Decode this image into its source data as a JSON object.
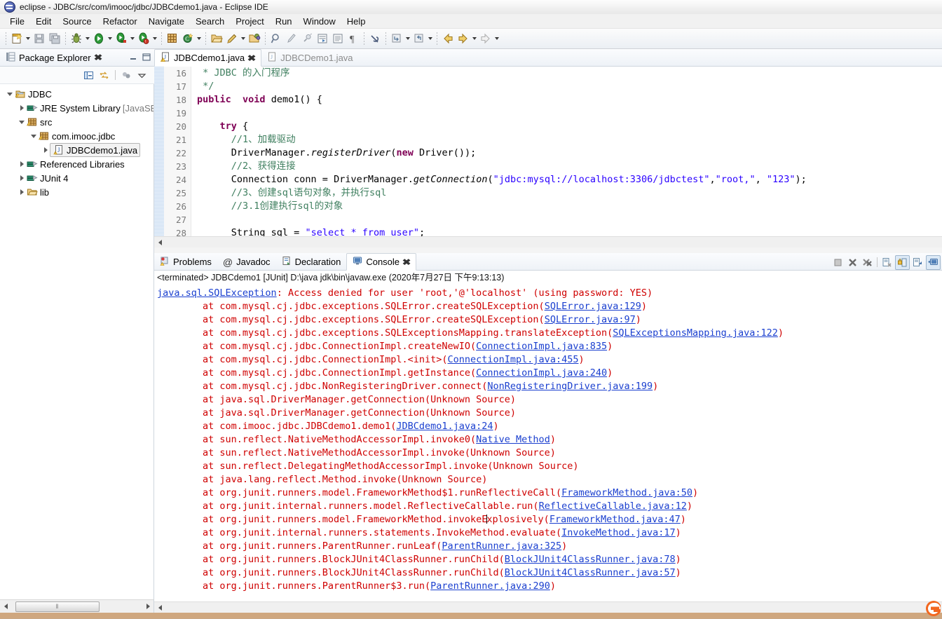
{
  "window": {
    "title": "eclipse - JDBC/src/com/imooc/jdbc/JDBCdemo1.java - Eclipse IDE",
    "logo_icon": "eclipse-logo-icon"
  },
  "menubar": {
    "items": [
      "File",
      "Edit",
      "Source",
      "Refactor",
      "Navigate",
      "Search",
      "Project",
      "Run",
      "Window",
      "Help"
    ]
  },
  "toolbar": {
    "groups": [
      {
        "buttons": [
          {
            "name": "new-wizard-icon",
            "glyph": "🗋",
            "color": "#e8b53a",
            "arrow": true
          },
          {
            "name": "save-icon",
            "glyph": "💾",
            "color": "#b9bec6",
            "arrow": false
          },
          {
            "name": "save-all-icon",
            "glyph": "🗐",
            "color": "#b9bec6",
            "arrow": false
          }
        ]
      },
      {
        "buttons": [
          {
            "name": "debug-icon",
            "glyph": "🐞",
            "color": "#6f8f3f",
            "arrow": true
          },
          {
            "name": "run-icon",
            "glyph": "▶",
            "color": "#2e9b3a",
            "arrow": true
          },
          {
            "name": "run-coverage-icon",
            "glyph": "▶",
            "color": "#2e9b3a",
            "arrow": true
          },
          {
            "name": "run-last-tool-icon",
            "glyph": "▶",
            "color": "#2e9b3a",
            "arrow": true
          }
        ]
      },
      {
        "buttons": [
          {
            "name": "new-java-package-icon",
            "glyph": "⊞",
            "color": "#c38a3c",
            "arrow": false
          },
          {
            "name": "new-java-class-icon",
            "glyph": "Ⓘ",
            "color": "#3a8f4a",
            "arrow": true
          }
        ]
      },
      {
        "buttons": [
          {
            "name": "open-type-icon",
            "glyph": "🗁",
            "color": "#d9a84b",
            "arrow": false
          },
          {
            "name": "quick-fix-icon",
            "glyph": "✎",
            "color": "#d2a23a",
            "arrow": true
          },
          {
            "name": "open-task-icon",
            "glyph": "🗂",
            "color": "#d9a84b",
            "arrow": false
          }
        ]
      },
      {
        "buttons": [
          {
            "name": "search-icon",
            "glyph": "🔍",
            "color": "#7f8fa0",
            "arrow": false
          },
          {
            "name": "pencil-icon",
            "glyph": "✒",
            "color": "#b0b6bd",
            "arrow": false
          },
          {
            "name": "link-icon",
            "glyph": "⚲",
            "color": "#b0b6bd",
            "arrow": false
          },
          {
            "name": "toggle-block-selection-icon",
            "glyph": "▤",
            "color": "#9aa1aa",
            "arrow": false
          },
          {
            "name": "show-whitespace-icon",
            "glyph": "☰",
            "color": "#9aa1aa",
            "arrow": false
          },
          {
            "name": "paragraph-mark-icon",
            "glyph": "¶",
            "color": "#6a6a6a",
            "arrow": false
          }
        ]
      },
      {
        "buttons": [
          {
            "name": "skip-breakpoints-icon",
            "glyph": "⊘",
            "color": "#4a5a7a",
            "arrow": false
          }
        ]
      },
      {
        "buttons": [
          {
            "name": "next-annotation-icon",
            "glyph": "⤵",
            "color": "#9aa1aa",
            "arrow": true
          },
          {
            "name": "previous-annotation-icon",
            "glyph": "⤴",
            "color": "#9aa1aa",
            "arrow": true
          }
        ]
      },
      {
        "buttons": [
          {
            "name": "back-navigation-icon",
            "glyph": "↩",
            "color": "#d6a53a",
            "arrow": false
          },
          {
            "name": "forward-navigation-icon",
            "glyph": "↪",
            "color": "#d6a53a",
            "arrow": true
          },
          {
            "name": "last-edit-location-icon",
            "glyph": "⇨",
            "color": "#c9c9c9",
            "arrow": true
          }
        ]
      }
    ]
  },
  "package_explorer": {
    "title": "Package Explorer",
    "close_icon": "close-icon",
    "view_icon": "package-explorer-icon",
    "minimize_icon": "minimize-icon",
    "maximize_icon": "maximize-icon",
    "toolbar": [
      {
        "name": "collapse-all-icon",
        "glyph": "−"
      },
      {
        "name": "link-with-editor-icon",
        "glyph": "⇄"
      },
      {
        "name": "focus-on-active-task-icon",
        "glyph": "⚇"
      },
      {
        "name": "view-menu-icon",
        "glyph": "▽"
      }
    ],
    "tree": [
      {
        "label": "JDBC",
        "icon": "java-project-icon",
        "indent": 0,
        "twisty": "open",
        "selected": false,
        "dim": ""
      },
      {
        "label": "JRE System Library",
        "icon": "library-icon",
        "indent": 1,
        "twisty": "closed",
        "selected": false,
        "dim": "[JavaSE"
      },
      {
        "label": "src",
        "icon": "source-folder-icon",
        "indent": 1,
        "twisty": "open",
        "selected": false,
        "dim": ""
      },
      {
        "label": "com.imooc.jdbc",
        "icon": "package-icon",
        "indent": 2,
        "twisty": "open",
        "selected": false,
        "dim": ""
      },
      {
        "label": "JDBCdemo1.java",
        "icon": "java-file-warning-icon",
        "indent": 3,
        "twisty": "closed",
        "selected": true,
        "dim": ""
      },
      {
        "label": "Referenced Libraries",
        "icon": "library-icon",
        "indent": 1,
        "twisty": "closed",
        "selected": false,
        "dim": ""
      },
      {
        "label": "JUnit 4",
        "icon": "library-icon",
        "indent": 1,
        "twisty": "closed",
        "selected": false,
        "dim": ""
      },
      {
        "label": "lib",
        "icon": "folder-icon",
        "indent": 1,
        "twisty": "closed",
        "selected": false,
        "dim": ""
      }
    ],
    "hscroll": {
      "left_arrow": "scroll-left-icon",
      "right_arrow": "scroll-right-icon",
      "thumb_glyph": "‖"
    }
  },
  "editor": {
    "tabs": [
      {
        "label": "JDBCdemo1.java",
        "icon": "java-file-warning-icon",
        "active": true,
        "close_icon": "close-icon"
      },
      {
        "label": "JDBCDemo1.java",
        "icon": "java-file-icon",
        "active": false,
        "close_icon": ""
      }
    ],
    "first_line_number": 16,
    "line_numbers": [
      16,
      17,
      18,
      19,
      20,
      21,
      22,
      23,
      24,
      25,
      26,
      27,
      28
    ],
    "lines": [
      " * JDBC 的入门程序",
      " */",
      "public  void demo1() {",
      "",
      "    try {",
      "      //1、加载驱动",
      "      DriverManager.registerDriver(new Driver());",
      "      //2、获得连接",
      "      Connection conn = DriverManager.getConnection(\"jdbc:mysql://localhost:3306/jdbctest\",\"root,\", \"123\");",
      "      //3、创建sql语句对象，并执行sql",
      "      //3.1创建执行sql的对象",
      "",
      "      String sql = \"select * from user\";"
    ]
  },
  "console": {
    "tabs": [
      {
        "label": "Problems",
        "icon": "problems-icon",
        "active": false
      },
      {
        "label": "Javadoc",
        "icon": "javadoc-icon",
        "active": false
      },
      {
        "label": "Declaration",
        "icon": "declaration-icon",
        "active": false
      },
      {
        "label": "Console",
        "icon": "console-icon",
        "active": true,
        "close_icon": "close-icon"
      }
    ],
    "toolbar": [
      {
        "name": "terminate-icon",
        "glyph": "■",
        "pressed": false
      },
      {
        "name": "remove-launch-icon",
        "glyph": "✖",
        "pressed": false
      },
      {
        "name": "remove-all-terminated-icon",
        "glyph": "✖",
        "pressed": false
      },
      {
        "name": "clear-console-icon",
        "glyph": "🗎",
        "pressed": false
      },
      {
        "name": "scroll-lock-icon",
        "glyph": "🔒",
        "pressed": true
      },
      {
        "name": "show-console-on-output-icon",
        "glyph": "↵",
        "pressed": false
      },
      {
        "name": "display-selected-console-icon",
        "glyph": "🗔",
        "pressed": false
      }
    ],
    "terminated_line": "<terminated> JDBCdemo1 [JUnit] D:\\java jdk\\bin\\javaw.exe (2020年7月27日 下午9:13:13)",
    "stack": [
      {
        "pre": "",
        "link": "java.sql.SQLException",
        "post": ": Access denied for user 'root,'@'localhost' (using password: YES)",
        "link_first": true
      },
      {
        "pre": "\tat com.mysql.cj.jdbc.exceptions.SQLError.createSQLException(",
        "link": "SQLError.java:129",
        "post": ")"
      },
      {
        "pre": "\tat com.mysql.cj.jdbc.exceptions.SQLError.createSQLException(",
        "link": "SQLError.java:97",
        "post": ")"
      },
      {
        "pre": "\tat com.mysql.cj.jdbc.exceptions.SQLExceptionsMapping.translateException(",
        "link": "SQLExceptionsMapping.java:122",
        "post": ")"
      },
      {
        "pre": "\tat com.mysql.cj.jdbc.ConnectionImpl.createNewIO(",
        "link": "ConnectionImpl.java:835",
        "post": ")"
      },
      {
        "pre": "\tat com.mysql.cj.jdbc.ConnectionImpl.<init>(",
        "link": "ConnectionImpl.java:455",
        "post": ")"
      },
      {
        "pre": "\tat com.mysql.cj.jdbc.ConnectionImpl.getInstance(",
        "link": "ConnectionImpl.java:240",
        "post": ")"
      },
      {
        "pre": "\tat com.mysql.cj.jdbc.NonRegisteringDriver.connect(",
        "link": "NonRegisteringDriver.java:199",
        "post": ")"
      },
      {
        "pre": "\tat java.sql.DriverManager.getConnection(Unknown Source)",
        "link": "",
        "post": ""
      },
      {
        "pre": "\tat java.sql.DriverManager.getConnection(Unknown Source)",
        "link": "",
        "post": ""
      },
      {
        "pre": "\tat com.imooc.jdbc.JDBCdemo1.demo1(",
        "link": "JDBCdemo1.java:24",
        "post": ")"
      },
      {
        "pre": "\tat sun.reflect.NativeMethodAccessorImpl.invoke0(",
        "link": "Native Method",
        "post": ")"
      },
      {
        "pre": "\tat sun.reflect.NativeMethodAccessorImpl.invoke(Unknown Source)",
        "link": "",
        "post": ""
      },
      {
        "pre": "\tat sun.reflect.DelegatingMethodAccessorImpl.invoke(Unknown Source)",
        "link": "",
        "post": ""
      },
      {
        "pre": "\tat java.lang.reflect.Method.invoke(Unknown Source)",
        "link": "",
        "post": ""
      },
      {
        "pre": "\tat org.junit.runners.model.FrameworkMethod$1.runReflectiveCall(",
        "link": "FrameworkMethod.java:50",
        "post": ")"
      },
      {
        "pre": "\tat org.junit.internal.runners.model.ReflectiveCallable.run(",
        "link": "ReflectiveCallable.java:12",
        "post": ")"
      },
      {
        "pre": "\tat org.junit.runners.model.FrameworkMethod.invokeExplosively(",
        "link": "FrameworkMethod.java:47",
        "post": ")",
        "caret_after": 50
      },
      {
        "pre": "\tat org.junit.internal.runners.statements.InvokeMethod.evaluate(",
        "link": "InvokeMethod.java:17",
        "post": ")"
      },
      {
        "pre": "\tat org.junit.runners.ParentRunner.runLeaf(",
        "link": "ParentRunner.java:325",
        "post": ")"
      },
      {
        "pre": "\tat org.junit.runners.BlockJUnit4ClassRunner.runChild(",
        "link": "BlockJUnit4ClassRunner.java:78",
        "post": ")"
      },
      {
        "pre": "\tat org.junit.runners.BlockJUnit4ClassRunner.runChild(",
        "link": "BlockJUnit4ClassRunner.java:57",
        "post": ")"
      },
      {
        "pre": "\tat org.junit.runners.ParentRunner$3.run(",
        "link": "ParentRunner.java:290",
        "post": ")"
      }
    ]
  },
  "tray": {
    "icon": "browser-tray-icon",
    "color": "#f2671f"
  },
  "colors": {
    "error_text": "#cf0000",
    "link": "#1a3fcf",
    "keyword": "#7f0055",
    "string": "#2a00ff",
    "comment": "#3f7f5f",
    "desktop": "#cba98a"
  }
}
